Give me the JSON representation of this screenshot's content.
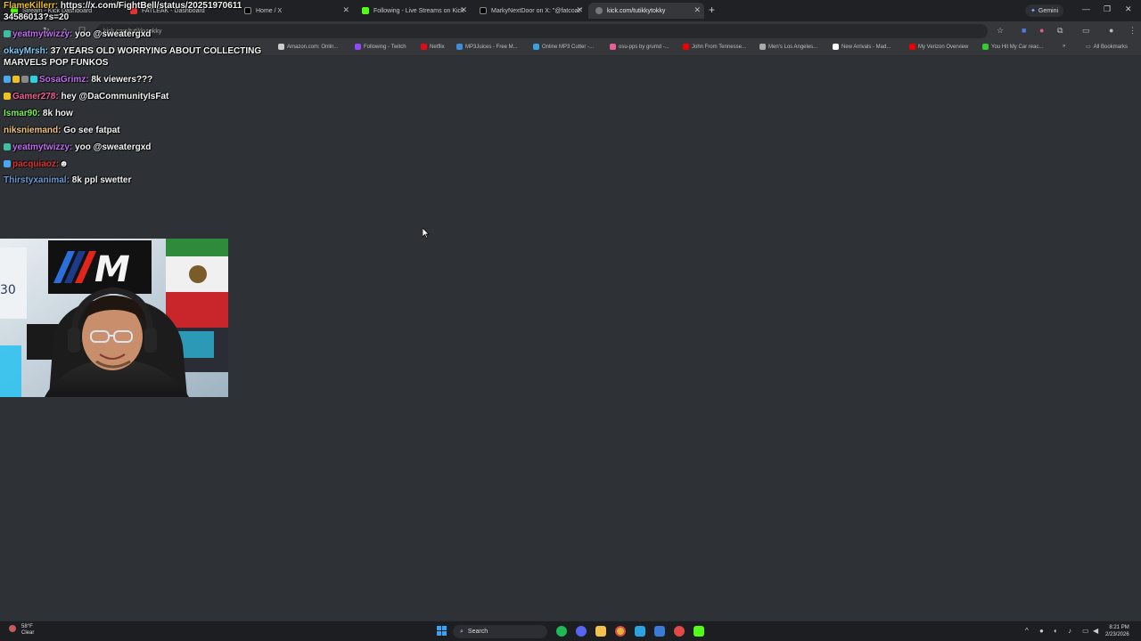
{
  "browser": {
    "tabs": [
      {
        "title": "Stream - Kick Dashboard",
        "active": false
      },
      {
        "title": "FATLEAK - Dashboard",
        "active": false
      },
      {
        "title": "Home / X",
        "active": false
      },
      {
        "title": "Following - Live Streams on Kick",
        "active": false
      },
      {
        "title": "MarkyNextDoor on X: \"@fatcoat\"",
        "active": false
      },
      {
        "title": "kick.com/tutikkytokky",
        "active": true
      }
    ],
    "new_tab": "+",
    "gemini_label": "Gemini",
    "address": "kick.com/tutikkytokky",
    "bookmarks": [
      "Amazon.com: Onlin...",
      "Following - Twitch",
      "Netflix",
      "MP3Juices - Free M...",
      "Online MP3 Cutter -...",
      "osu-pps by grumd -...",
      "John From Tennesse...",
      "Men's Los Angeles...",
      "New Arrivals - Mad...",
      "My Verizon Overview",
      "You Hit My Car reac..."
    ],
    "all_bookmarks": "All Bookmarks"
  },
  "chat": {
    "messages": [
      {
        "user": "FlameKillerr:",
        "user_color": "#f0c020",
        "text": " https://x.com/FightBell/status/20251970611 34586013?s=20",
        "line2": "34586013?s=20"
      },
      {
        "user": "yeatmytwizzy:",
        "user_color": "#c06cf0",
        "text": " yoo @sweatergxd"
      },
      {
        "user": "okayMrsh:",
        "user_color": "#7ec8f5",
        "text": " 37 YEARS OLD WORRYING ABOUT COLLECTING",
        "line2": "MARVELS POP FUNKOS"
      },
      {
        "user": "SosaGrimz:",
        "user_color": "#c06cf0",
        "text": " 8k viewers???"
      },
      {
        "user": "Gamer278:",
        "user_color": "#f06090",
        "text": " hey @DaCommunityIsFat"
      },
      {
        "user": "Ismar90:",
        "user_color": "#7cf05a",
        "text": " 8k how"
      },
      {
        "user": "niksniemand:",
        "user_color": "#f0c080",
        "text": " Go see fatpat"
      },
      {
        "user": "yeatmytwizzy:",
        "user_color": "#c06cf0",
        "text": " yoo @sweatergxd"
      },
      {
        "user": "pacquiaoz:",
        "user_color": "#e03030",
        "text": " "
      },
      {
        "user": "Thirstyxanimal:",
        "user_color": "#6a9ad6",
        "text": " 8k ppl swetter"
      }
    ]
  },
  "taskbar": {
    "weather_temp": "58°F",
    "weather_desc": "Clear",
    "search_placeholder": "Search",
    "time": "8:21 PM",
    "date": "2/23/2026"
  }
}
